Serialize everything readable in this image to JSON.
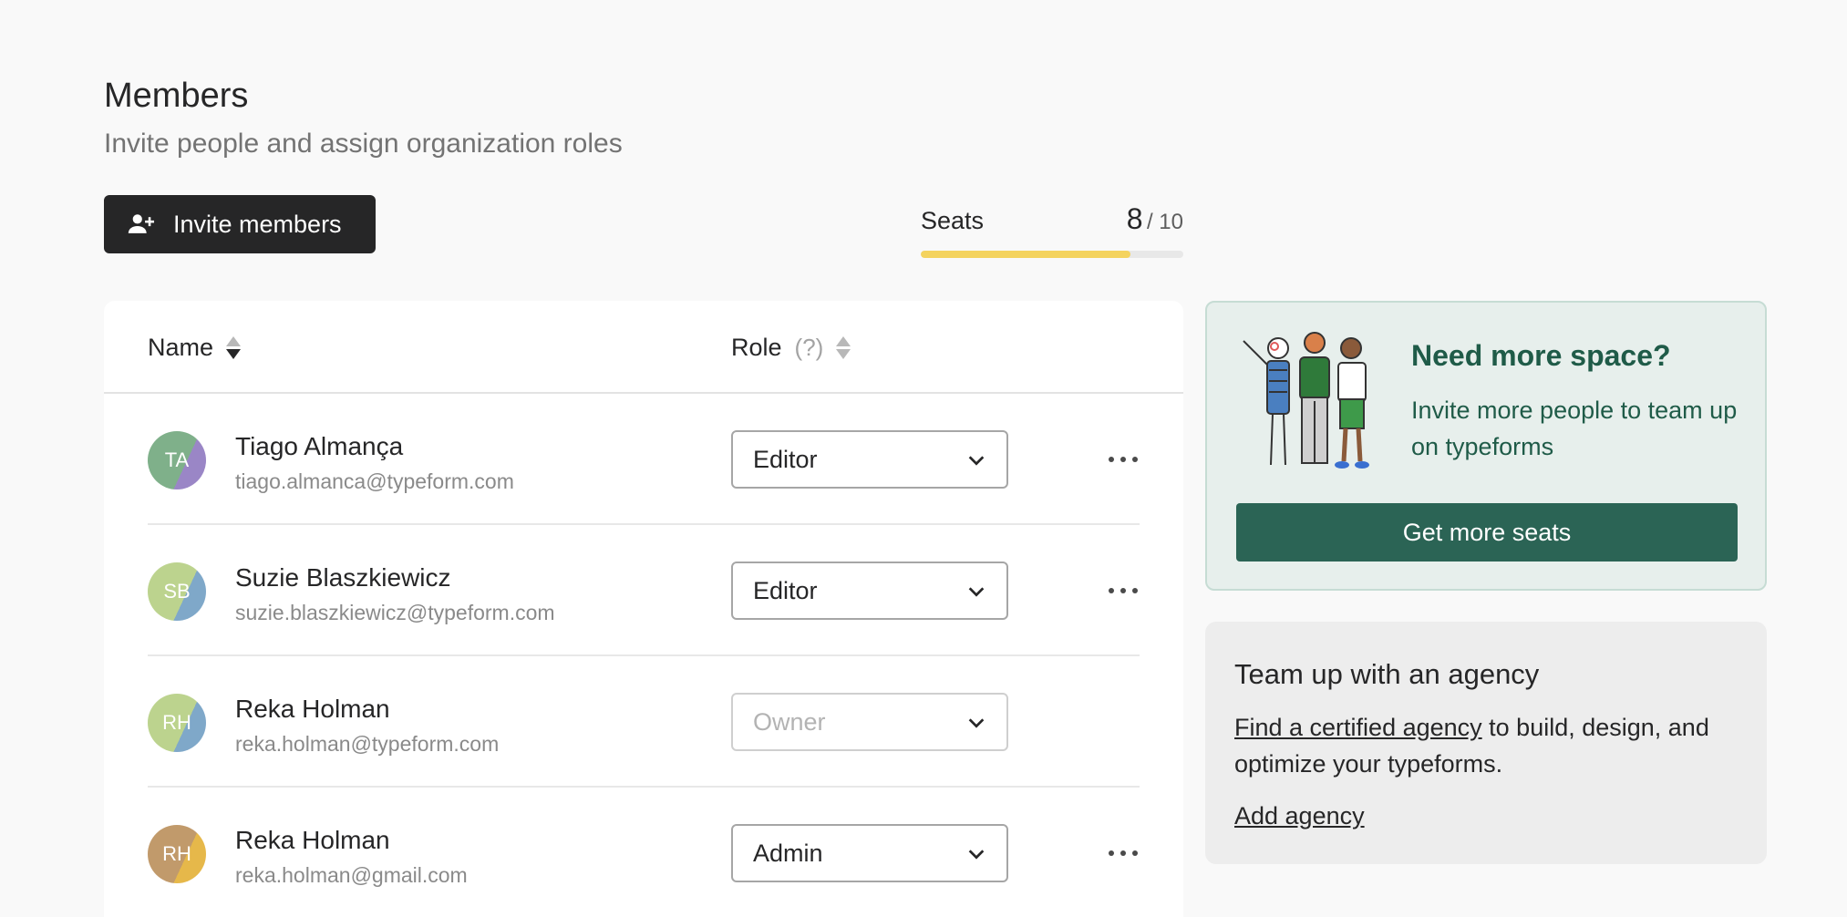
{
  "header": {
    "title": "Members",
    "subtitle": "Invite people and assign organization roles"
  },
  "invite_button": {
    "label": "Invite members",
    "icon": "add-person-icon"
  },
  "seats": {
    "label": "Seats",
    "used": "8",
    "total": "/ 10",
    "fill_fraction": 0.8,
    "bar_color": "#f4d35e"
  },
  "table": {
    "columns": {
      "name": "Name",
      "role": "Role",
      "role_help": "(?)"
    },
    "members": [
      {
        "initials": "TA",
        "name": "Tiago Almança",
        "email": "tiago.almanca@typeform.com",
        "role": "Editor",
        "editable": true,
        "avatar_colors": [
          "#7fb08a",
          "#9a86c6"
        ]
      },
      {
        "initials": "SB",
        "name": "Suzie Blaszkiewicz",
        "email": "suzie.blaszkiewicz@typeform.com",
        "role": "Editor",
        "editable": true,
        "avatar_colors": [
          "#bcd38e",
          "#7fa8c9"
        ]
      },
      {
        "initials": "RH",
        "name": "Reka Holman",
        "email": "reka.holman@typeform.com",
        "role": "Owner",
        "editable": false,
        "avatar_colors": [
          "#bcd38e",
          "#7fa8c9"
        ]
      },
      {
        "initials": "RH",
        "name": "Reka Holman",
        "email": "reka.holman@gmail.com",
        "role": "Admin",
        "editable": true,
        "avatar_colors": [
          "#c19a6b",
          "#e6b84a"
        ]
      }
    ]
  },
  "promo": {
    "title": "Need more space?",
    "text": "Invite more people to team up on typeforms",
    "button": "Get more seats",
    "accent": "#2b6455"
  },
  "agency": {
    "title": "Team up with an agency",
    "link_text": "Find a certified agency",
    "text_rest": " to build, design, and optimize your typeforms.",
    "add_link": "Add agency"
  }
}
